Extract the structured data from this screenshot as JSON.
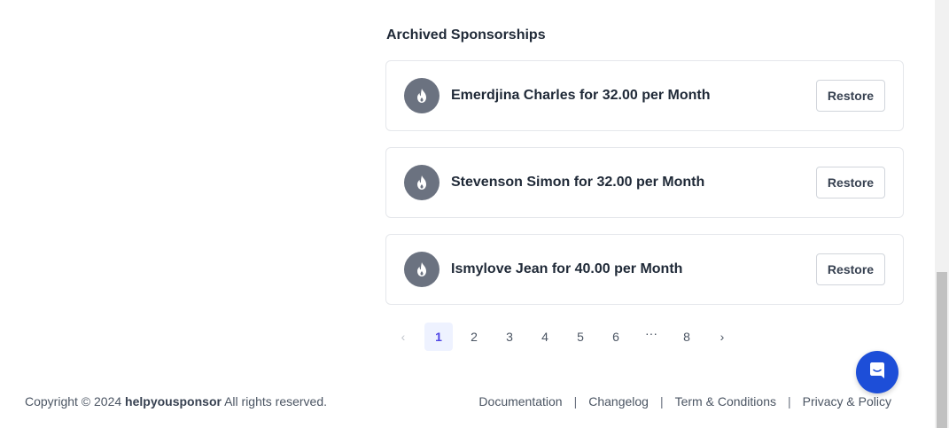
{
  "section": {
    "title": "Archived Sponsorships"
  },
  "sponsorships": [
    {
      "label": "Emerdjina Charles for 32.00 per Month",
      "button": "Restore"
    },
    {
      "label": "Stevenson Simon for 32.00 per Month",
      "button": "Restore"
    },
    {
      "label": "Ismylove Jean for 40.00 per Month",
      "button": "Restore"
    }
  ],
  "pagination": {
    "prev": "‹",
    "pages": [
      "1",
      "2",
      "3",
      "4",
      "5",
      "6"
    ],
    "ellipsis": "···",
    "last": "8",
    "next": "›",
    "current": "1"
  },
  "footer": {
    "copyright_prefix": "Copyright © 2024",
    "brand": "helpyousponsor",
    "copyright_suffix": "All rights reserved.",
    "links": [
      "Documentation",
      "Changelog",
      "Term & Conditions",
      "Privacy & Policy"
    ],
    "separator": "|"
  },
  "icons": {
    "avatar": "flame-icon",
    "chat": "chat-icon"
  },
  "colors": {
    "avatar_bg": "#6b7280",
    "chat_bg": "#1d4ed8",
    "active_page_bg": "#eef2ff",
    "active_page_text": "#4f46e5"
  }
}
